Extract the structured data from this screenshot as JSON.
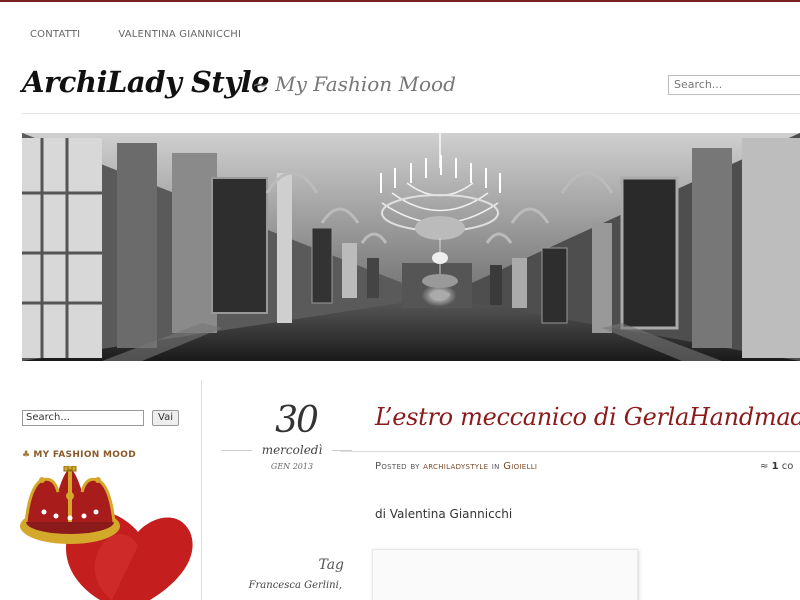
{
  "top_nav": {
    "items": [
      {
        "label": "CONTATTI"
      },
      {
        "label": "VALENTINA GIANNICCHI"
      }
    ]
  },
  "header": {
    "site_title": "ArchiLady Style",
    "tagline": "~ My Fashion Mood",
    "search_placeholder": "Search..."
  },
  "banner": {
    "icon": "gallery-chandelier-photo"
  },
  "sidebar": {
    "search_value": "Search...",
    "search_button": "Vai",
    "widget_title": "MY FASHION MOOD",
    "widget_bullet": "♣",
    "widget_image_icon": "crown-heart-image",
    "colors": {
      "heart": "#c41e1e",
      "crown": "#d4a82a"
    }
  },
  "post": {
    "date": {
      "day": "30",
      "weekday": "mercoledì",
      "month_year": "GEN 2013"
    },
    "title": "L’estro meccanico di GerlaHandmade",
    "meta": {
      "posted_by": "Posted by",
      "author": "archiladystyle",
      "in": "in",
      "category": "Gioielli"
    },
    "comments": {
      "icon": "≈",
      "count": "1",
      "label": "co"
    },
    "byline": "di Valentina Giannicchi",
    "tags_heading": "Tag",
    "tags": [
      "Francesca Gerlini,"
    ]
  },
  "colors": {
    "accent": "#8b1a1a",
    "top_line": "#7a1f1f"
  }
}
